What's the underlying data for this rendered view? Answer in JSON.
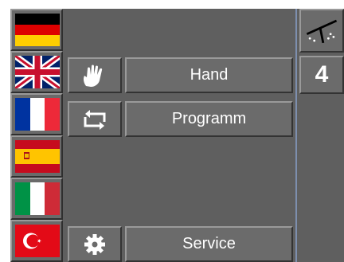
{
  "languages": [
    {
      "name": "flag-germany-icon",
      "active": false
    },
    {
      "name": "flag-uk-icon",
      "active": false
    },
    {
      "name": "flag-france-icon",
      "active": false
    },
    {
      "name": "flag-spain-icon",
      "active": false
    },
    {
      "name": "flag-italy-icon",
      "active": false
    },
    {
      "name": "flag-turkey-icon",
      "active": false
    }
  ],
  "menu": {
    "hand": {
      "label": "Hand",
      "icon": "hand-icon"
    },
    "programm": {
      "label": "Programm",
      "icon": "repeat-icon"
    },
    "service": {
      "label": "Service",
      "icon": "gear-icon"
    }
  },
  "right_panel": {
    "top_icon": "swing-arm-icon",
    "number": "4"
  },
  "colors": {
    "panel_bg": "#5f5f5f",
    "button_bg": "#6b6b6b",
    "text": "#ffffff",
    "divider": "#7d8fae"
  }
}
